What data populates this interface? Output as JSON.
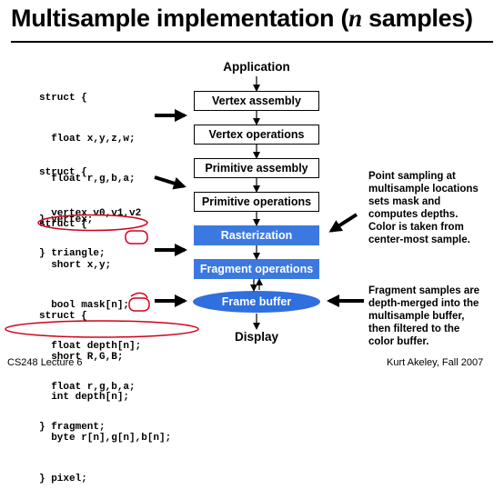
{
  "slide": {
    "title_prefix": "Multisample implementation (",
    "title_var": "n",
    "title_suffix": " samples)"
  },
  "pipeline": {
    "top_label": "Application",
    "stages": [
      "Vertex assembly",
      "Vertex operations",
      "Primitive assembly",
      "Primitive operations",
      "Rasterization",
      "Fragment operations"
    ],
    "frame_buffer": "Frame buffer",
    "bottom_label": "Display"
  },
  "code": {
    "vertex": [
      "struct {",
      "  float x,y,z,w;",
      "  float r,g,b,a;",
      "} vertex;"
    ],
    "triangle": [
      "struct {",
      "  vertex v0,v1,v2",
      "} triangle;"
    ],
    "fragment": [
      "struct {",
      "  short x,y;",
      "  bool mask[n];",
      "  float depth[n];",
      "  float r,g,b,a;",
      "} fragment;"
    ],
    "pixel": [
      "struct {",
      "  short R,G,B;",
      "  int depth[n];",
      "  byte r[n],g[n],b[n];",
      "} pixel;"
    ]
  },
  "notes": {
    "rasterization": [
      "Point sampling at",
      "multisample locations",
      "sets mask and",
      "computes depths.",
      "Color is taken from",
      "center-most sample."
    ],
    "frame_buffer": [
      "Fragment samples are",
      "depth-merged into the",
      "multisample buffer,",
      "then filtered to the",
      "color buffer."
    ]
  },
  "footer": {
    "left": "CS248 Lecture 6",
    "right": "Kurt Akeley, Fall 2007"
  },
  "colors": {
    "highlight_blue": "#3b79e0",
    "annotation_red": "#d0021b"
  }
}
